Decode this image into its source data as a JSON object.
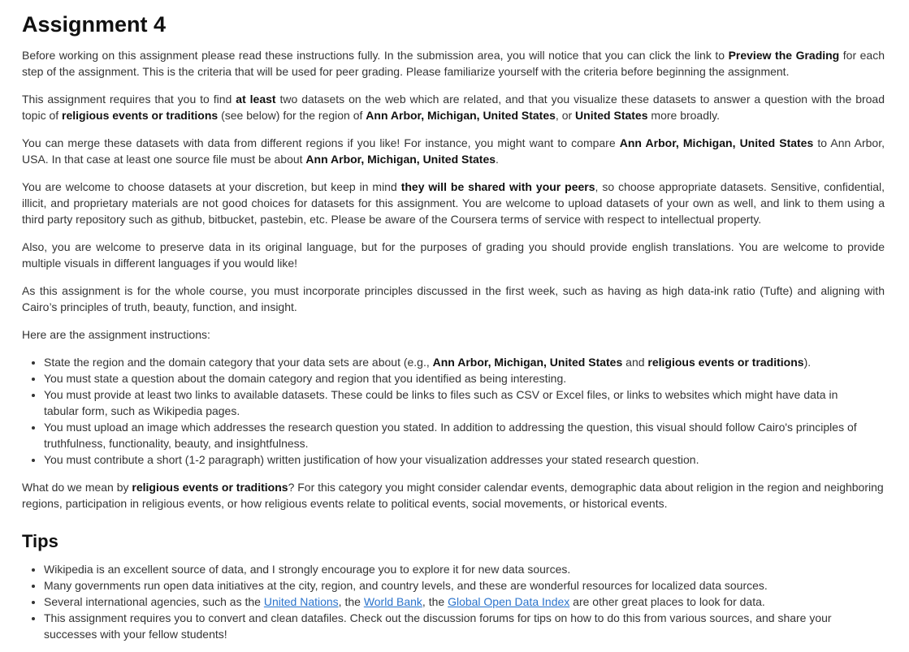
{
  "title": "Assignment 4",
  "intro": {
    "p1_a": "Before working on this assignment please read these instructions fully. In the submission area, you will notice that you can click the link to ",
    "p1_b": "Preview the Grading",
    "p1_c": " for each step of the assignment. This is the criteria that will be used for peer grading. Please familiarize yourself with the criteria before beginning the assignment.",
    "p2_a": "This assignment requires that you to find ",
    "p2_b": "at least",
    "p2_c": " two datasets on the web which are related, and that you visualize these datasets to answer a question with the broad topic of ",
    "p2_d": "religious events or traditions",
    "p2_e": " (see below) for the region of ",
    "p2_f": "Ann Arbor, Michigan, United States",
    "p2_g": ", or ",
    "p2_h": "United States",
    "p2_i": " more broadly.",
    "p3_a": "You can merge these datasets with data from different regions if you like! For instance, you might want to compare ",
    "p3_b": "Ann Arbor, Michigan, United States",
    "p3_c": " to Ann Arbor, USA. In that case at least one source file must be about ",
    "p3_d": "Ann Arbor, Michigan, United States",
    "p3_e": ".",
    "p4_a": "You are welcome to choose datasets at your discretion, but keep in mind ",
    "p4_b": "they will be shared with your peers",
    "p4_c": ", so choose appropriate datasets. Sensitive, confidential, illicit, and proprietary materials are not good choices for datasets for this assignment. You are welcome to upload datasets of your own as well, and link to them using a third party repository such as github, bitbucket, pastebin, etc. Please be aware of the Coursera terms of service with respect to intellectual property.",
    "p5": "Also, you are welcome to preserve data in its original language, but for the purposes of grading you should provide english translations. You are welcome to provide multiple visuals in different languages if you would like!",
    "p6": "As this assignment is for the whole course, you must incorporate principles discussed in the first week, such as having as high data-ink ratio (Tufte) and aligning with Cairo’s principles of truth, beauty, function, and insight.",
    "p7": "Here are the assignment instructions:"
  },
  "instructions": {
    "i1_a": "State the region and the domain category that your data sets are about (e.g., ",
    "i1_b": "Ann Arbor, Michigan, United States",
    "i1_c": " and ",
    "i1_d": "religious events or traditions",
    "i1_e": ").",
    "i2": "You must state a question about the domain category and region that you identified as being interesting.",
    "i3": "You must provide at least two links to available datasets. These could be links to files such as CSV or Excel files, or links to websites which might have data in tabular form, such as Wikipedia pages.",
    "i4": "You must upload an image which addresses the research question you stated. In addition to addressing the question, this visual should follow Cairo's principles of truthfulness, functionality, beauty, and insightfulness.",
    "i5": "You must contribute a short (1-2 paragraph) written justification of how your visualization addresses your stated research question."
  },
  "whatmean": {
    "a": "What do we mean by ",
    "b": "religious events or traditions",
    "c": "? For this category you might consider calendar events, demographic data about religion in the region and neighboring regions, participation in religious events, or how religious events relate to political events, social movements, or historical events."
  },
  "tips": {
    "heading": "Tips",
    "t1": "Wikipedia is an excellent source of data, and I strongly encourage you to explore it for new data sources.",
    "t2": "Many governments run open data initiatives at the city, region, and country levels, and these are wonderful resources for localized data sources.",
    "t3_a": "Several international agencies, such as the ",
    "t3_link1": "United Nations",
    "t3_b": ", the ",
    "t3_link2": "World Bank",
    "t3_c": ", the ",
    "t3_link3": "Global Open Data Index",
    "t3_d": " are other great places to look for data.",
    "t4": "This assignment requires you to convert and clean datafiles. Check out the discussion forums for tips on how to do this from various sources, and share your successes with your fellow students!"
  },
  "colors": {
    "text": "#333333",
    "heading": "#111111",
    "link": "#2a73cc"
  }
}
